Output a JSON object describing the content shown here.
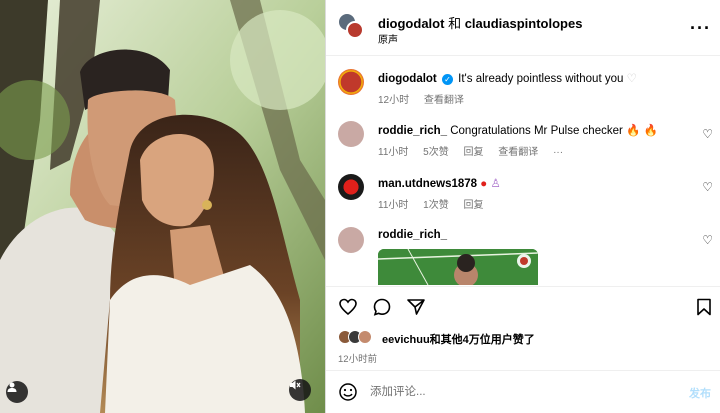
{
  "header": {
    "user_primary": "diogodalot",
    "conjunction": "和",
    "user_secondary": "claudiaspintolopes",
    "audio_label": "原声"
  },
  "caption": {
    "username": "diogodalot",
    "text": "It's already pointless without you",
    "time": "12小时",
    "translate": "查看翻译"
  },
  "comments": [
    {
      "username": "roddie_rich_",
      "text": "Congratulations Mr Pulse checker",
      "time": "11小时",
      "likes": "5次赞",
      "reply": "回复",
      "translate": "查看翻译",
      "more": "···"
    },
    {
      "username": "man.utdnews1878",
      "text": "",
      "time": "11小时",
      "likes": "1次赞",
      "reply": "回复"
    },
    {
      "username": "roddie_rich_",
      "text": ""
    }
  ],
  "likes": {
    "text": "eevichuu和其他4万位用户赞了"
  },
  "post_time": "12小时前",
  "comment_box": {
    "placeholder": "添加评论...",
    "post_label": "发布"
  },
  "icons": [
    "heart-icon",
    "comment-icon",
    "share-icon",
    "bookmark-icon",
    "emoji-icon",
    "more-icon",
    "user-icon",
    "mute-icon"
  ],
  "colors": {
    "verified": "#0095f6",
    "post_disabled": "#b2dffc",
    "meta": "#737373"
  }
}
